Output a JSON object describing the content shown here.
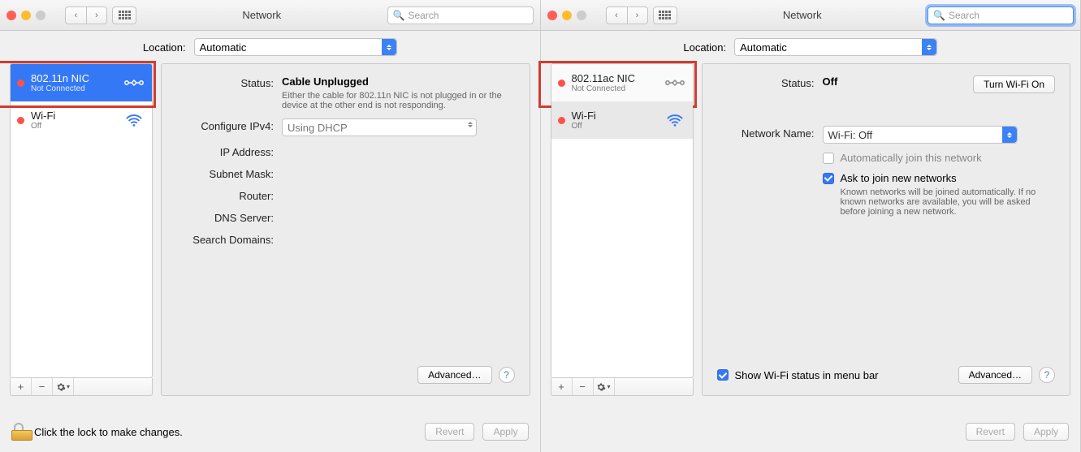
{
  "left": {
    "toolbar": {
      "title": "Network",
      "search_placeholder": "Search"
    },
    "location": {
      "label": "Location:",
      "value": "Automatic"
    },
    "sidebar": {
      "items": [
        {
          "name": "802.11n NIC",
          "status": "Not Connected"
        },
        {
          "name": "Wi-Fi",
          "status": "Off"
        }
      ]
    },
    "detail": {
      "status_label": "Status:",
      "status_value": "Cable Unplugged",
      "status_hint": "Either the cable for 802.11n NIC is not plugged in or the device at the other end is not responding.",
      "configure_label": "Configure IPv4:",
      "configure_value": "Using DHCP",
      "ip_label": "IP Address:",
      "subnet_label": "Subnet Mask:",
      "router_label": "Router:",
      "dns_label": "DNS Server:",
      "search_label": "Search Domains:",
      "advanced_btn": "Advanced…"
    },
    "bottom": {
      "lock_text": "Click the lock to make changes.",
      "revert": "Revert",
      "apply": "Apply"
    }
  },
  "right": {
    "toolbar": {
      "title": "Network",
      "search_placeholder": "Search"
    },
    "location": {
      "label": "Location:",
      "value": "Automatic"
    },
    "sidebar": {
      "items": [
        {
          "name": "802.11ac NIC",
          "status": "Not Connected"
        },
        {
          "name": "Wi-Fi",
          "status": "Off"
        }
      ]
    },
    "detail": {
      "status_label": "Status:",
      "status_value": "Off",
      "toggle_btn": "Turn Wi-Fi On",
      "network_name_label": "Network Name:",
      "network_name_value": "Wi-Fi: Off",
      "auto_join_label": "Automatically join this network",
      "ask_join_label": "Ask to join new networks",
      "ask_join_hint": "Known networks will be joined automatically. If no known networks are available, you will be asked before joining a new network.",
      "show_status_label": "Show Wi-Fi status in menu bar",
      "advanced_btn": "Advanced…"
    },
    "bottom": {
      "revert": "Revert",
      "apply": "Apply"
    }
  }
}
